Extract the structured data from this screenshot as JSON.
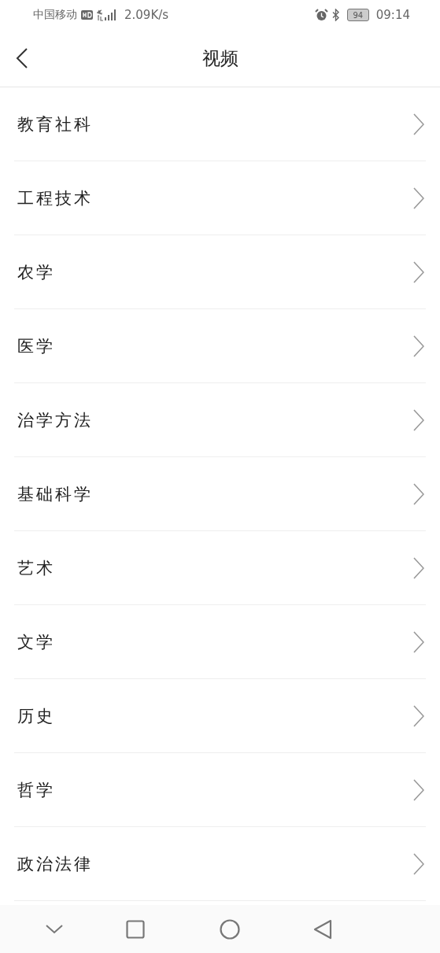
{
  "status_bar": {
    "carrier": "中国移动",
    "speed": "2.09K/s",
    "battery": "94",
    "time": "09:14"
  },
  "header": {
    "title": "视频"
  },
  "items": [
    {
      "label": "教育社科"
    },
    {
      "label": "工程技术"
    },
    {
      "label": "农学"
    },
    {
      "label": "医学"
    },
    {
      "label": "治学方法"
    },
    {
      "label": "基础科学"
    },
    {
      "label": "艺术"
    },
    {
      "label": "文学"
    },
    {
      "label": "历史"
    },
    {
      "label": "哲学"
    },
    {
      "label": "政治法律"
    }
  ]
}
